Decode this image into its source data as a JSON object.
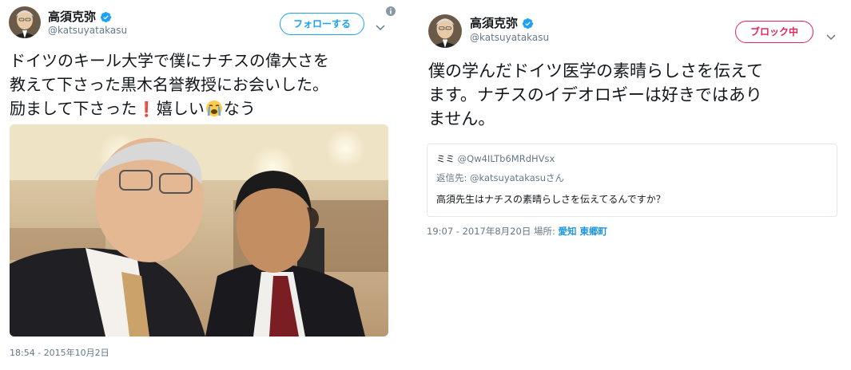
{
  "tweet1": {
    "user": {
      "name": "高須克弥",
      "handle": "@katsuyatakasu",
      "avatar_icon": "avatar-photo",
      "verified_icon": "verified-badge-icon"
    },
    "follow_label": "フォローする",
    "more_icon": "chevron-down-icon",
    "info_icon": "info-icon",
    "text_lines": [
      "ドイツのキール大学で僕にナチスの偉大さを",
      "教えて下さった黒木名誉教授にお会いした。",
      "励まして下さった",
      "嬉しい",
      "なう"
    ],
    "emoji": {
      "exclamation": "❗",
      "crying": "😭"
    },
    "photo_icon": "photo-two-men",
    "timestamp": "18:54 - 2015年10月2日"
  },
  "tweet2": {
    "user": {
      "name": "高須克弥",
      "handle": "@katsuyatakasu",
      "avatar_icon": "avatar-photo",
      "verified_icon": "verified-badge-icon"
    },
    "block_label": "ブロック中",
    "more_icon": "chevron-down-icon",
    "text_lines": [
      "僕の学んだドイツ医学の素晴らしさを伝えて",
      "ます。ナチスのイデオロギーは好きではあり",
      "ません。"
    ],
    "quoted": {
      "name": "ミミ",
      "handle": "@Qw4ILTb6MRdHVsx",
      "reply_prefix": "返信先:",
      "reply_handle": "@katsuyatakasu",
      "reply_suffix": "さん",
      "text": "高須先生はナチスの素晴らしさを伝えてるんですか？"
    },
    "timestamp": "19:07 - 2017年8月20日",
    "location_prefix": "場所:",
    "location": "愛知 東郷町"
  },
  "colors": {
    "primary_text": "#14171a",
    "secondary_text": "#657786",
    "twitter_blue": "#1da1f2",
    "link_blue": "#1b95e0",
    "block_red": "#e0245e",
    "border": "#e1e8ed"
  }
}
